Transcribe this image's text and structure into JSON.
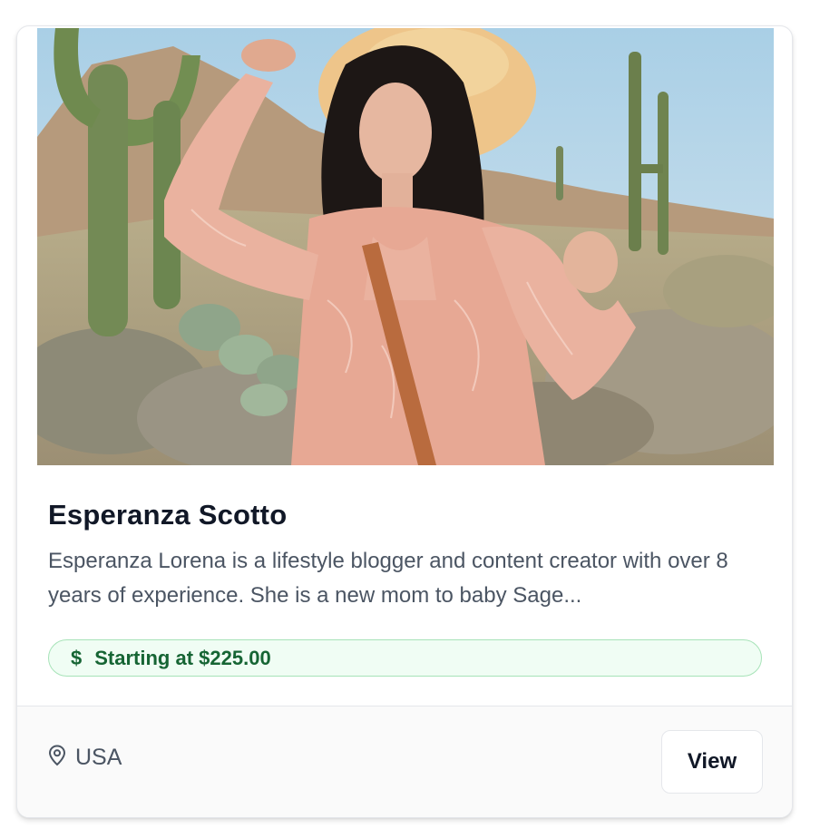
{
  "profile": {
    "name": "Esperanza Scotto",
    "description": "Esperanza Lorena is a lifestyle blogger and content creator with over 8 years of experience. She is a new mom to baby Sage...",
    "price_label": "Starting at $225.00",
    "price_icon": "$",
    "location": "USA",
    "view_label": "View"
  },
  "icons": {
    "price": "dollar-icon",
    "location": "map-pin-icon"
  },
  "colors": {
    "badge_bg": "#f0fdf4",
    "badge_border": "#a7e3b8",
    "badge_text": "#166534",
    "title": "#111827",
    "body_text": "#4b5563"
  }
}
